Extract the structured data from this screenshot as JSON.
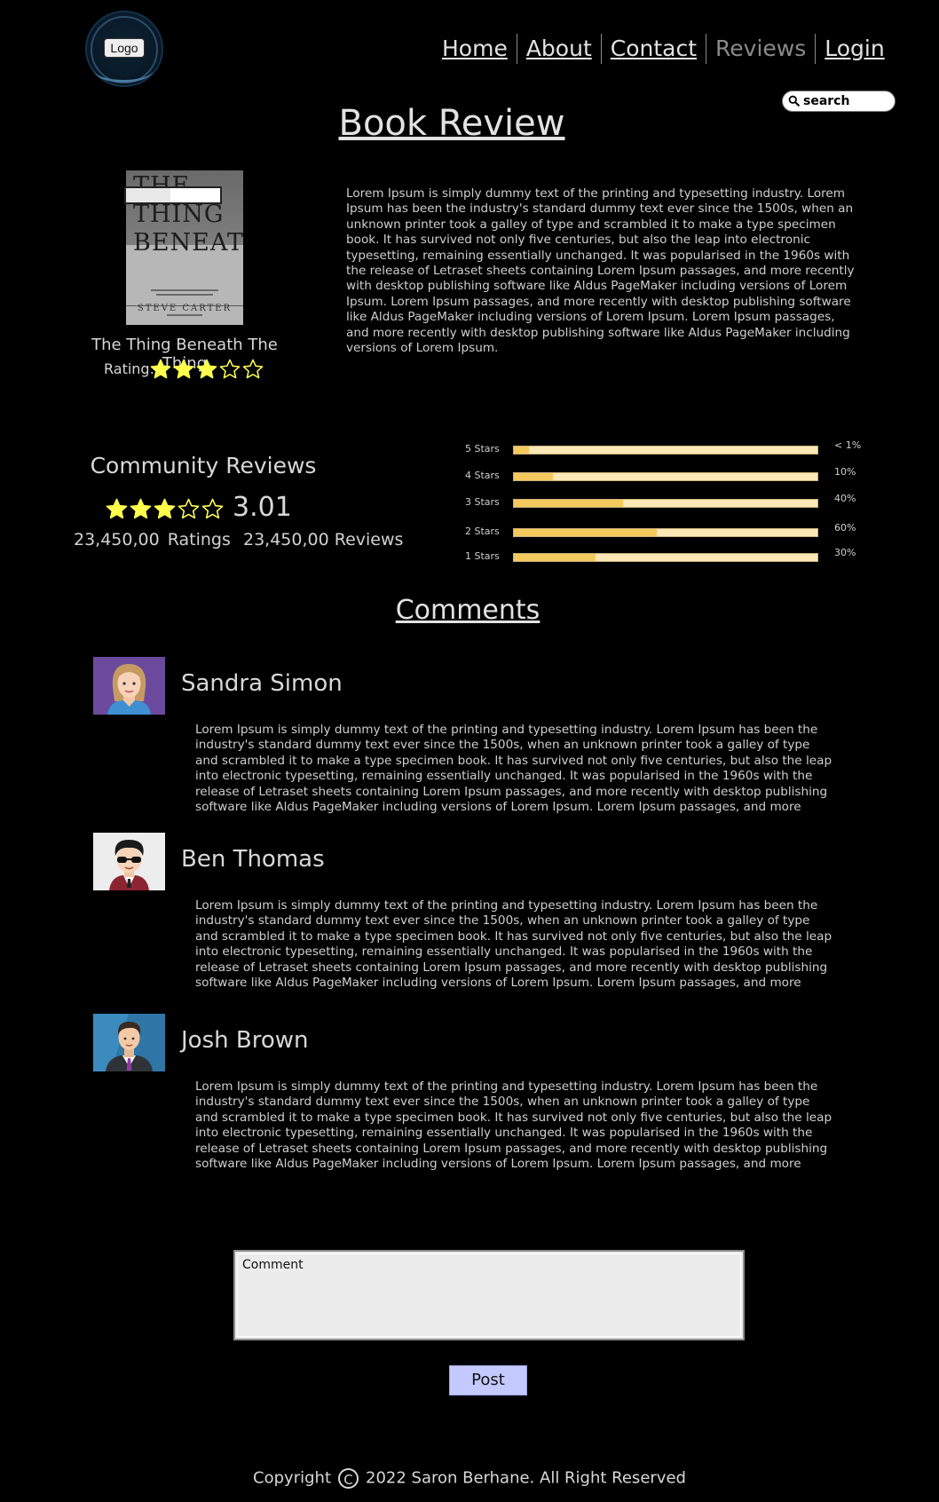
{
  "header": {
    "logo_text": "Logo",
    "nav": [
      {
        "label": "Home",
        "active": false
      },
      {
        "label": "About",
        "active": false
      },
      {
        "label": "Contact",
        "active": false
      },
      {
        "label": "Reviews",
        "active": true
      },
      {
        "label": "Login",
        "active": false
      }
    ],
    "search_placeholder": "search"
  },
  "page_title": "Book Review",
  "book": {
    "title": "The Thing Beneath The Thing",
    "cover_title": "THE THING BENEATH",
    "cover_author": "STEVE CARTER",
    "rating_label": "Rating:",
    "rating_stars": 3,
    "description": "Lorem Ipsum is simply dummy text of the printing and typesetting industry. Lorem Ipsum has been the industry's standard dummy text ever since the 1500s, when an unknown printer took a galley of type and scrambled it to make a type specimen book. It has survived not only five centuries, but also the leap into electronic typesetting, remaining essentially unchanged. It was popularised in the 1960s with the release of Letraset sheets containing Lorem Ipsum passages, and more recently with desktop publishing software like Aldus PageMaker including versions of Lorem Ipsum. Lorem Ipsum passages, and more recently with desktop publishing software like Aldus PageMaker including versions of Lorem Ipsum. Lorem Ipsum passages, and more recently with desktop publishing software like Aldus PageMaker including versions of Lorem Ipsum."
  },
  "community": {
    "title": "Community Reviews",
    "stars": 3,
    "average": "3.01",
    "ratings": "23,450,00  Ratings",
    "reviews": "23,450,00 Reviews",
    "breakdown": [
      {
        "label": "5 Stars",
        "percent_text": "< 1%",
        "fill": 0.05
      },
      {
        "label": "4 Stars",
        "percent_text": "10%",
        "fill": 0.13
      },
      {
        "label": "3 Stars",
        "percent_text": "40%",
        "fill": 0.36
      },
      {
        "label": "2 Stars",
        "percent_text": "60%",
        "fill": 0.47
      },
      {
        "label": "1 Stars",
        "percent_text": "30%",
        "fill": 0.27
      }
    ]
  },
  "comments": {
    "title": "Comments",
    "items": [
      {
        "name": "Sandra Simon",
        "text": "Lorem Ipsum is simply dummy text of the printing and typesetting industry. Lorem Ipsum has been the industry's standard dummy text ever since the 1500s, when an unknown printer took a galley of type and scrambled it to make a type specimen book. It has survived not only five centuries, but also the leap into electronic typesetting, remaining essentially unchanged. It was popularised in the 1960s with the release of Letraset sheets containing Lorem Ipsum passages, and more recently with desktop publishing software like Aldus PageMaker including versions of Lorem Ipsum. Lorem Ipsum passages, and more recently with desktop"
      },
      {
        "name": "Ben Thomas",
        "text": "Lorem Ipsum is simply dummy text of the printing and typesetting industry. Lorem Ipsum has been the industry's standard dummy text ever since the 1500s, when an unknown printer took a galley of type and scrambled it to make a type specimen book. It has survived not only five centuries, but also the leap into electronic typesetting, remaining essentially unchanged. It was popularised in the 1960s with the release of Letraset sheets containing Lorem Ipsum passages, and more recently with desktop publishing software like Aldus PageMaker including versions of Lorem Ipsum. Lorem Ipsum passages, and more recently with desktop"
      },
      {
        "name": "Josh Brown",
        "text": "Lorem Ipsum is simply dummy text of the printing and typesetting industry. Lorem Ipsum has been the industry's standard dummy text ever since the 1500s, when an unknown printer took a galley of type and scrambled it to make a type specimen book. It has survived not only five centuries, but also the leap into electronic typesetting, remaining essentially unchanged. It was popularised in the 1960s with the release of Letraset sheets containing Lorem Ipsum passages, and more recently with desktop publishing software like Aldus PageMaker including versions of Lorem Ipsum. Lorem Ipsum passages, and more recently with desktop"
      }
    ],
    "input_placeholder": "Comment",
    "post_label": "Post"
  },
  "footer": {
    "before": "Copyright",
    "symbol": "C",
    "after": "2022 Saron Berhane. All Right Reserved"
  },
  "colors": {
    "background": "#000000",
    "star": "#ffff4d",
    "bar_fill": "#f4c95e",
    "bar_track": "#fbe8b6",
    "post_button": "#c4c9ff"
  }
}
